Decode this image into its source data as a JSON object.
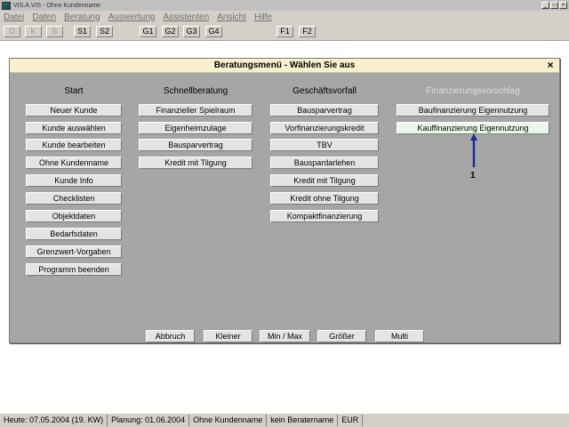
{
  "window": {
    "title": "VIS.A.VIS - Ohne Kundenname",
    "controls": [
      "_",
      "□",
      "×"
    ]
  },
  "menubar": {
    "items": [
      "Datei",
      "Daten",
      "Beratung",
      "Auswertung",
      "Assistenten",
      "Ansicht",
      "Hilfe"
    ]
  },
  "toolbar": {
    "buttons": [
      "O",
      "K",
      "B",
      "S1",
      "S2",
      "G1",
      "G2",
      "G3",
      "G4",
      "F1",
      "F2"
    ]
  },
  "dialog": {
    "title": "Beratungsmenü - Wählen Sie aus",
    "close_label": "×",
    "columns": [
      {
        "heading": "Start",
        "buttons": [
          "Neuer Kunde",
          "Kunde auswählen",
          "Kunde bearbeiten",
          "Ohne Kundenname",
          "Kunde Info",
          "Checklisten",
          "Objektdaten",
          "Bedarfsdaten",
          "Grenzwert-Vorgaben",
          "Programm beenden"
        ]
      },
      {
        "heading": "Schnellberatung",
        "buttons": [
          "Finanzieller Spielraum",
          "Eigenheimzulage",
          "Bausparvertrag",
          "Kredit mit Tilgung"
        ]
      },
      {
        "heading": "Geschäftsvorfall",
        "buttons": [
          "Bausparvertrag",
          "Vorfinanzierungskredit",
          "TBV",
          "Bauspardarlehen",
          "Kredit mit Tilgung",
          "Kredit ohne Tilgung",
          "Kompaktfinanzierung"
        ]
      },
      {
        "heading": "Finanzierungsvorschlag",
        "buttons": [
          "Baufinanzierung Eigennutzung",
          "Kauffinanzierung Eigennutzung"
        ]
      }
    ],
    "annotation": "1",
    "footer_buttons": [
      "Abbruch",
      "Kleiner",
      "Min / Max",
      "Größer",
      "Multi"
    ]
  },
  "statusbar": {
    "cells": [
      "Heute: 07.05.2004 (19. KW)",
      "Planung: 01.06.2004",
      "Ohne Kundenname",
      "kein Beratername",
      "EUR"
    ]
  }
}
